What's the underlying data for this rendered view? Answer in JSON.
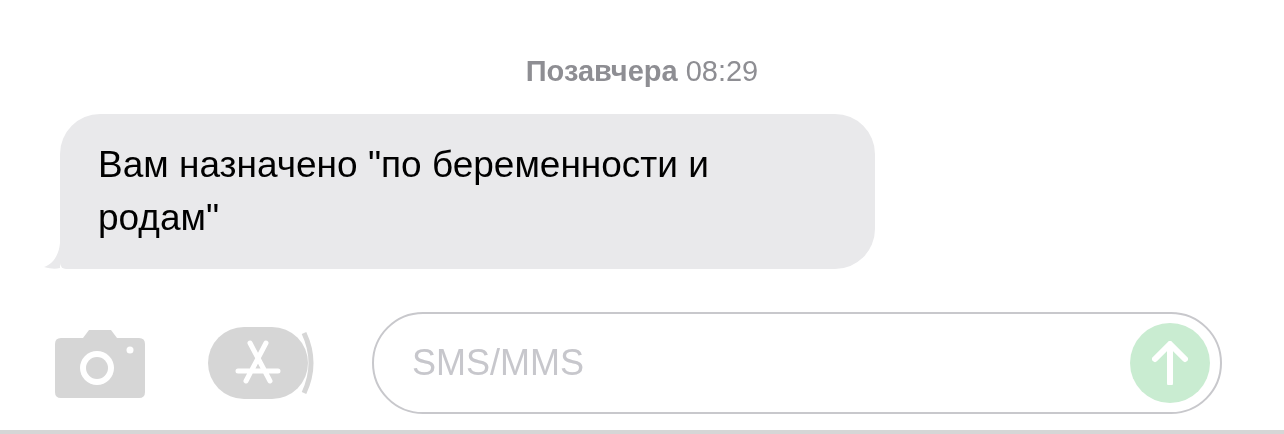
{
  "timestamp": {
    "day": "Позавчера",
    "time": "08:29"
  },
  "messages": [
    {
      "kind": "incoming",
      "text": "Вам назначено \"по беременности и родам\""
    }
  ],
  "composer": {
    "placeholder": "SMS/MMS",
    "send_disabled": true
  }
}
